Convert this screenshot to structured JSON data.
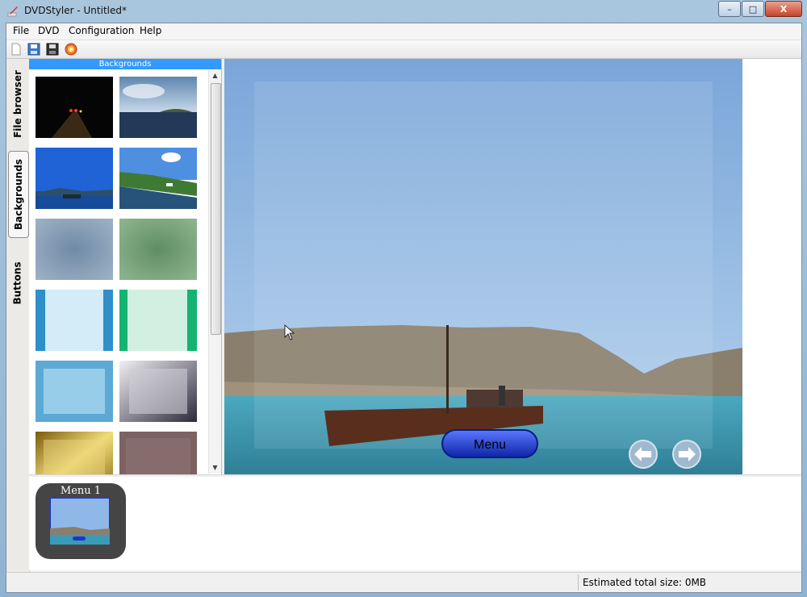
{
  "window": {
    "title": "DVDStyler - Untitled*",
    "minimize": "–",
    "maximize": "□",
    "close": "X"
  },
  "menubar": {
    "items": [
      "File",
      "DVD",
      "Configuration",
      "Help"
    ]
  },
  "toolbar": {
    "icons": [
      "new-file-icon",
      "save-icon",
      "save-as-icon",
      "burn-disc-icon"
    ]
  },
  "side_tabs": [
    "File browser",
    "Backgrounds",
    "Buttons"
  ],
  "panel": {
    "header": "Backgrounds",
    "thumbnails": [
      "night-road",
      "sea-island",
      "blue-shipwreck",
      "coast-village",
      "blue-gray-blur",
      "green-blur",
      "blue-stripes",
      "green-stripes",
      "light-blue-frame",
      "gray-frame",
      "gold-frame",
      "dark-texture"
    ]
  },
  "canvas": {
    "menu_button": "Menu",
    "nav_icons": [
      "arrow-left-icon",
      "arrow-right-icon"
    ]
  },
  "menus": [
    {
      "title": "Menu 1"
    }
  ],
  "status": {
    "size_label": "Estimated total size: 0MB"
  },
  "colors": {
    "accent": "#3399ff",
    "sky": "#8fb8e8",
    "sea": "#3a9bb8",
    "menu_button": "#1a35c8"
  }
}
